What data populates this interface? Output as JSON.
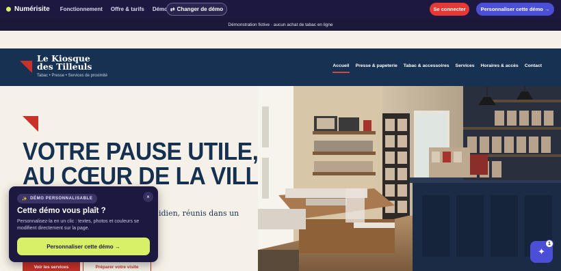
{
  "topbar": {
    "brand": "Numérisite",
    "nav": [
      "Fonctionnement",
      "Offre & tarifs",
      "Démos"
    ],
    "switch_demo": "Changer de démo",
    "login": "Se connecter",
    "customize": "Personnaliser cette démo →"
  },
  "notice": "Démonstration fictive · aucun achat de tabac en ligne",
  "site": {
    "name": "Le Kiosque des Tilleuls",
    "tagline": "Tabac • Presse • Services de proximité",
    "nav": [
      "Accueil",
      "Presse & papeterie",
      "Tabac & accessoires",
      "Services",
      "Horaires & accès",
      "Contact"
    ]
  },
  "hero": {
    "title_line1": "VOTRE PAUSE UTILE,",
    "title_line2": "AU CŒUR DE LA VILLE.",
    "subtitle": "idien, réunis dans un",
    "btn_primary": "Voir les services",
    "btn_secondary": "Préparer votre visite"
  },
  "popup": {
    "badge": "DÉMO PERSONNALISABLE",
    "title": "Cette démo vous plaît ?",
    "text": "Personnalisez-la en un clic : textes, photos et couleurs se modifient directement sur la page.",
    "cta": "Personnaliser cette démo  →",
    "close": "×"
  },
  "fab": {
    "badge": "1",
    "icon": "sparkle-icon"
  },
  "colors": {
    "navy": "#173153",
    "red": "#c8322b",
    "platform": "#1d1840",
    "accent": "#4b4fd6",
    "lime": "#d8f068"
  }
}
